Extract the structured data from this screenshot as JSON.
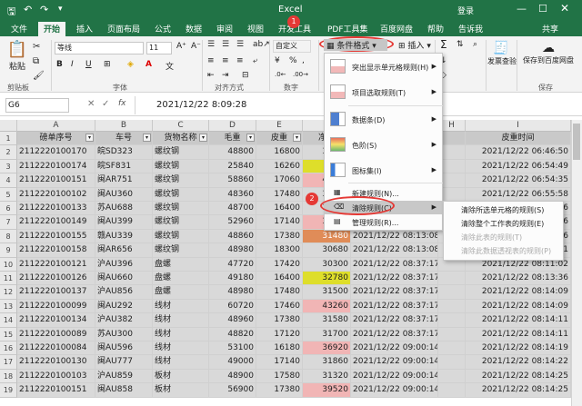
{
  "title_bar": {
    "app_title": "Excel",
    "login": "登录"
  },
  "tabs": [
    "文件",
    "开始",
    "插入",
    "页面布局",
    "公式",
    "数据",
    "审阅",
    "视图",
    "开发工具",
    "PDF工具集",
    "百度网盘",
    "帮助",
    "告诉我",
    "共享"
  ],
  "ribbon": {
    "paste": "粘贴",
    "clipboard": "剪贴板",
    "font_name": "等线",
    "font_size": "11",
    "font": "字体",
    "alignment": "对齐方式",
    "number_format": "自定义",
    "number": "数字",
    "cond_format": "条件格式",
    "insert": "插入",
    "invoice_check": "发票查验",
    "save_to_baidu": "保存到百度网盘",
    "save": "保存"
  },
  "formula_bar": {
    "name_box": "G6",
    "fx": "fx",
    "value": "2021/12/22  8:09:28"
  },
  "columns": [
    "A",
    "B",
    "C",
    "D",
    "E",
    "F",
    "G",
    "H",
    "I"
  ],
  "headers": [
    "磅单序号",
    "车号",
    "货物名称",
    "毛重",
    "皮重",
    "净重",
    "",
    "",
    "皮重时间"
  ],
  "rows": [
    {
      "r": "2",
      "a": "2112220100170",
      "b": "皖SD323",
      "c": "螺纹钢",
      "d": "48800",
      "e": "16800",
      "f": "32000",
      "g": "",
      "i": "2021/12/22 06:46:50",
      "fc": "none"
    },
    {
      "r": "3",
      "a": "2112220100174",
      "b": "皖SF831",
      "c": "螺纹钢",
      "d": "25840",
      "e": "16260",
      "f": "9580",
      "g": "",
      "i": "2021/12/22 06:54:49",
      "fc": "yellow"
    },
    {
      "r": "4",
      "a": "2112220100151",
      "b": "闽AR751",
      "c": "螺纹钢",
      "d": "58860",
      "e": "17060",
      "f": "41800",
      "g": "",
      "i": "2021/12/22 06:54:35",
      "fc": "pink"
    },
    {
      "r": "5",
      "a": "2112220100102",
      "b": "闽AU360",
      "c": "螺纹钢",
      "d": "48360",
      "e": "17480",
      "f": "30880",
      "g": "",
      "i": "2021/12/22 06:55:58",
      "fc": "none"
    },
    {
      "r": "6",
      "a": "2112220100133",
      "b": "苏AU688",
      "c": "螺纹钢",
      "d": "48700",
      "e": "16400",
      "f": "32300",
      "g": "",
      "i": "2021/12/22 07:11:16",
      "fc": "none"
    },
    {
      "r": "7",
      "a": "2112220100149",
      "b": "闽AU399",
      "c": "螺纹钢",
      "d": "52960",
      "e": "17140",
      "f": "35820",
      "g": "",
      "i": "2021/12/22 07:11:16",
      "fc": "pink"
    },
    {
      "r": "8",
      "a": "2112220100155",
      "b": "赣AU339",
      "c": "螺纹钢",
      "d": "48860",
      "e": "17380",
      "f": "31480",
      "g": "2021/12/22 08:13:08",
      "i": "2021/12/22 07:51:56",
      "fc": "orange"
    },
    {
      "r": "9",
      "a": "2112220100158",
      "b": "闽AR656",
      "c": "螺纹钢",
      "d": "48980",
      "e": "18300",
      "f": "30680",
      "g": "2021/12/22 08:13:08",
      "i": "2021/12/22 07:56:01",
      "fc": "none"
    },
    {
      "r": "10",
      "a": "2112220100121",
      "b": "沪AU396",
      "c": "盘螺",
      "d": "47720",
      "e": "17420",
      "f": "30300",
      "g": "2021/12/22 08:37:17",
      "i": "2021/12/22 08:11:02",
      "fc": "none"
    },
    {
      "r": "11",
      "a": "2112220100126",
      "b": "闽AU660",
      "c": "盘螺",
      "d": "49180",
      "e": "16400",
      "f": "32780",
      "g": "2021/12/22 08:37:17",
      "i": "2021/12/22 08:13:36",
      "fc": "yellow"
    },
    {
      "r": "12",
      "a": "2112220100137",
      "b": "沪AU856",
      "c": "盘螺",
      "d": "48980",
      "e": "17480",
      "f": "31500",
      "g": "2021/12/22 08:37:17",
      "i": "2021/12/22 08:14:09",
      "fc": "none"
    },
    {
      "r": "13",
      "a": "2112220100099",
      "b": "闽AU292",
      "c": "线材",
      "d": "60720",
      "e": "17460",
      "f": "43260",
      "g": "2021/12/22 08:37:17",
      "i": "2021/12/22 08:14:09",
      "fc": "pink"
    },
    {
      "r": "14",
      "a": "2112220100134",
      "b": "沪AU382",
      "c": "线材",
      "d": "48960",
      "e": "17380",
      "f": "31580",
      "g": "2021/12/22 08:37:17",
      "i": "2021/12/22 08:14:11",
      "fc": "none"
    },
    {
      "r": "15",
      "a": "2112220100089",
      "b": "苏AU300",
      "c": "线材",
      "d": "48820",
      "e": "17120",
      "f": "31700",
      "g": "2021/12/22 08:37:17",
      "i": "2021/12/22 08:14:11",
      "fc": "none"
    },
    {
      "r": "16",
      "a": "2112220100084",
      "b": "闽AU596",
      "c": "线材",
      "d": "53100",
      "e": "16180",
      "f": "36920",
      "g": "2021/12/22 09:00:14",
      "i": "2021/12/22 08:14:19",
      "fc": "pink"
    },
    {
      "r": "17",
      "a": "2112220100130",
      "b": "闽AU777",
      "c": "线材",
      "d": "49000",
      "e": "17140",
      "f": "31860",
      "g": "2021/12/22 09:00:14",
      "i": "2021/12/22 08:14:22",
      "fc": "none"
    },
    {
      "r": "18",
      "a": "2112220100103",
      "b": "沪AU859",
      "c": "板材",
      "d": "48900",
      "e": "17580",
      "f": "31320",
      "g": "2021/12/22 09:00:14",
      "i": "2021/12/22 08:14:25",
      "fc": "none"
    },
    {
      "r": "19",
      "a": "2112220100151",
      "b": "闽AU858",
      "c": "板材",
      "d": "56900",
      "e": "17380",
      "f": "39520",
      "g": "2021/12/22 09:00:14",
      "i": "2021/12/22 08:14:25",
      "fc": "pink"
    }
  ],
  "menu": [
    {
      "label": "突出显示单元格规则(H)",
      "arrow": "▶"
    },
    {
      "label": "项目选取规则(T)",
      "arrow": "▶"
    },
    {
      "label": "数据条(D)",
      "arrow": "▶"
    },
    {
      "label": "色阶(S)",
      "arrow": "▶"
    },
    {
      "label": "图标集(I)",
      "arrow": "▶"
    },
    {
      "label": "新建规则(N)..."
    },
    {
      "label": "清除规则(C)",
      "arrow": "▶"
    },
    {
      "label": "管理规则(R)..."
    }
  ],
  "submenu": [
    "清除所选单元格的规则(S)",
    "清除整个工作表的规则(E)",
    "清除此表的规则(T)",
    "清除此数据透视表的规则(P)"
  ],
  "markers": [
    "1",
    "2"
  ],
  "colors": {
    "green": "#217346",
    "yellow": "#dede2a",
    "pink": "#f1b5b5",
    "orange": "#e08c58",
    "red": "#e53935"
  }
}
